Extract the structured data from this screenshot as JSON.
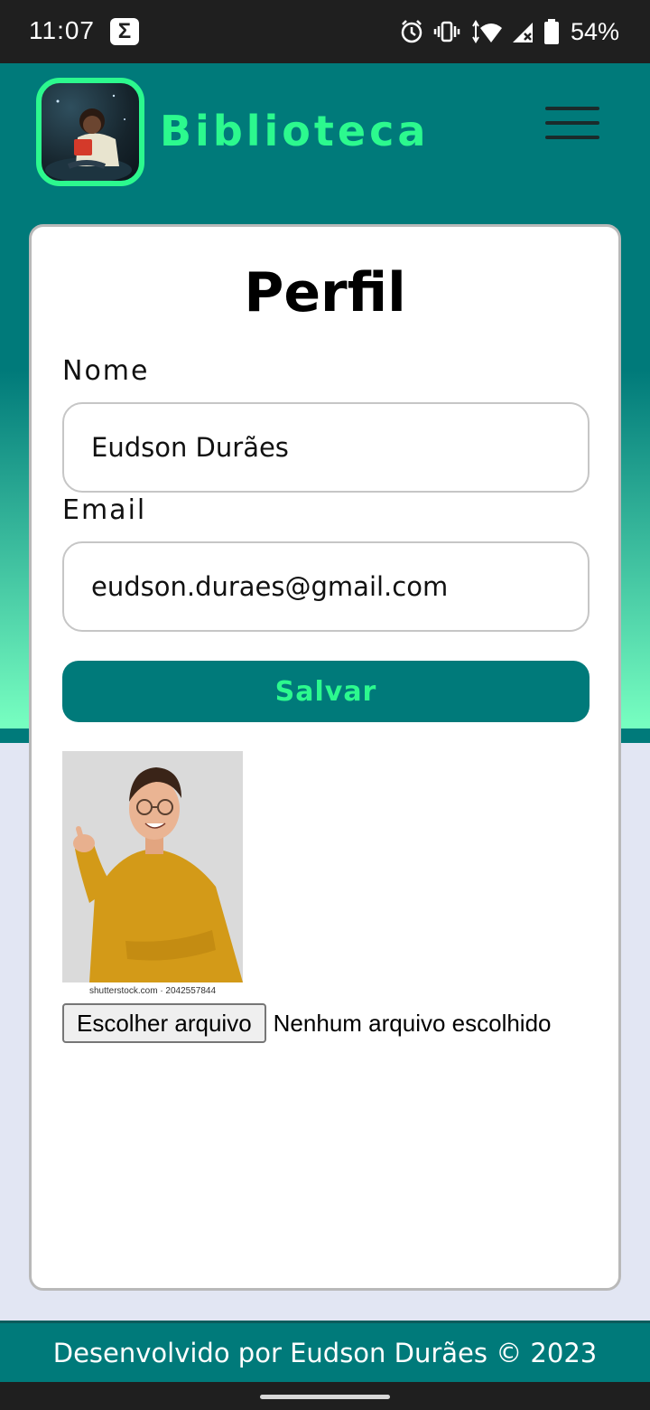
{
  "status_bar": {
    "time": "11:07",
    "battery": "54%",
    "icons": [
      "sigma-icon",
      "alarm-icon",
      "vibrate-icon",
      "wifi-icon",
      "signal-icon",
      "battery-icon"
    ]
  },
  "header": {
    "brand": "Biblioteca",
    "logo_icon": "logo-reading-boy",
    "menu_icon": "hamburger-menu-icon"
  },
  "profile": {
    "title": "Perfil",
    "name_label": "Nome",
    "name_value": "Eudson Durães",
    "email_label": "Email",
    "email_value": "eudson.duraes@gmail.com",
    "save_label": "Salvar",
    "photo_watermark": "shutterstock.com · 2042557844",
    "file_button_label": "Escolher arquivo",
    "file_status": "Nenhum arquivo escolhido"
  },
  "footer": {
    "text": "Desenvolvido por Eudson Durães © 2023"
  },
  "colors": {
    "primary_teal": "#007a7a",
    "accent_green": "#2cf98e",
    "gradient_light": "#76fdc0",
    "page_bg": "#e2e6f3"
  }
}
